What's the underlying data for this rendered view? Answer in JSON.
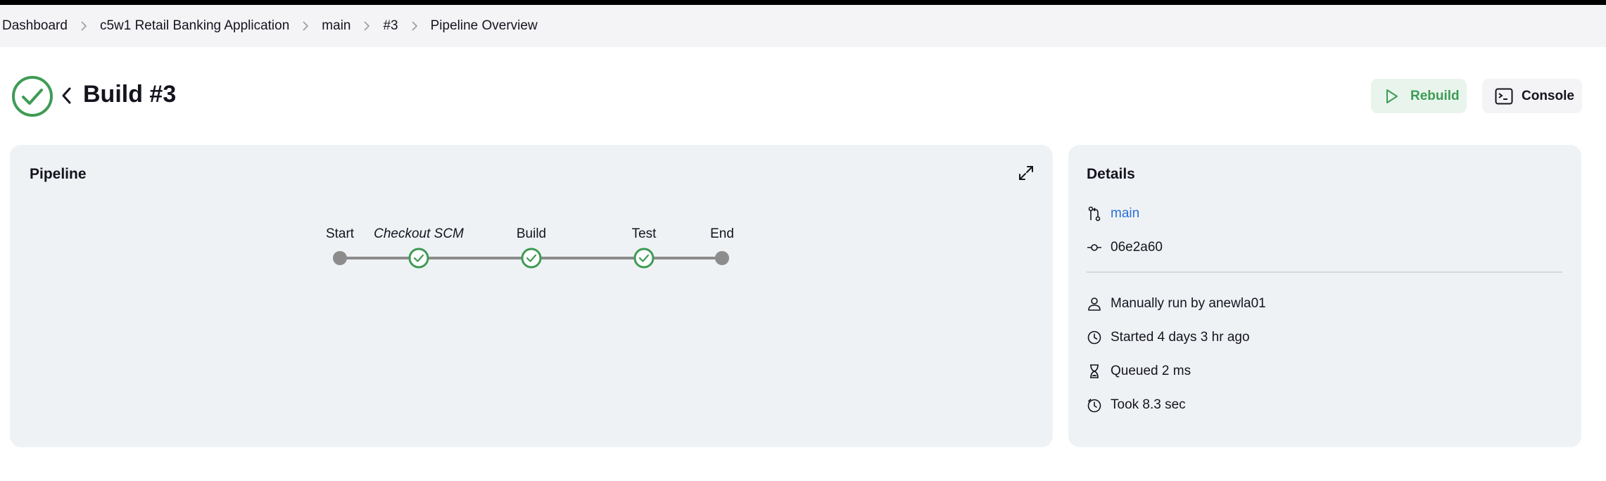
{
  "breadcrumb": [
    "Dashboard",
    "c5w1 Retail Banking Application",
    "main",
    "#3",
    "Pipeline Overview"
  ],
  "header": {
    "title": "Build #3",
    "status": "success",
    "rebuild_label": "Rebuild",
    "console_label": "Console"
  },
  "pipeline": {
    "title": "Pipeline",
    "stages": [
      {
        "label": "Start",
        "kind": "start"
      },
      {
        "label": "Checkout SCM",
        "kind": "success"
      },
      {
        "label": "Build",
        "kind": "success"
      },
      {
        "label": "Test",
        "kind": "success"
      },
      {
        "label": "End",
        "kind": "end"
      }
    ]
  },
  "details": {
    "title": "Details",
    "branch": "main",
    "commit": "06e2a60",
    "trigger": "Manually run by anewla01",
    "started": "Started 4 days 3 hr ago",
    "queued": "Queued 2 ms",
    "duration": "Took 8.3 sec"
  },
  "colors": {
    "success": "#3e9b55",
    "link": "#2a6fd8",
    "node_gray": "#8c8c8c"
  }
}
